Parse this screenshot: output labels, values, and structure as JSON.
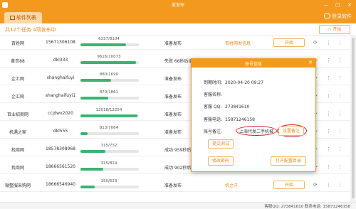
{
  "window": {
    "title": "爱发布",
    "minimize": "—",
    "maximize": "▢",
    "close": "✕"
  },
  "tabs": {
    "active": "软件列表"
  },
  "header": {
    "login": "登录软件"
  },
  "summary": {
    "text": "共12个任务 4项发布中",
    "start_all": "开始"
  },
  "columns_rows": [
    {
      "site": "百姓网",
      "account": "15671306108",
      "progress": "6337/8104",
      "progress_fraction": 0.78,
      "status": "准备发布",
      "log": "百姓网发信息",
      "button": "开始"
    },
    {
      "site": "黄页88",
      "account": "dkl333",
      "progress": "9616/10073",
      "progress_fraction": 0.95,
      "status": "失败 66秒后继",
      "log": "",
      "button": ""
    },
    {
      "site": "企汇网",
      "account": "shanghaifuyi",
      "progress": "880/1690",
      "progress_fraction": 0.52,
      "status": "准备发布",
      "log": "",
      "button": ""
    },
    {
      "site": "企汇网",
      "account": "shanghaifuyi1",
      "progress": "879/1861",
      "progress_fraction": 0.47,
      "status": "准备发布",
      "log": "",
      "button": ""
    },
    {
      "site": "百业招商网",
      "account": "ccjdwx2020",
      "progress": "12018/12254",
      "progress_fraction": 0.98,
      "status": "准备发布",
      "log": "",
      "button": ""
    },
    {
      "site": "机遇之家",
      "account": "dkl555",
      "progress": "813/7064",
      "progress_fraction": 0.12,
      "status": "准备发布",
      "log": "",
      "button": ""
    },
    {
      "site": "找商网",
      "account": "18578308968",
      "progress": "315/732",
      "progress_fraction": 0.43,
      "status": "成功 959秒后继",
      "log": "",
      "button": ""
    },
    {
      "site": "找商网",
      "account": "18666561520",
      "progress": "315/814",
      "progress_fraction": 0.39,
      "status": "成功 902秒后继",
      "log": "",
      "button": ""
    },
    {
      "site": "微整服采购网",
      "account": "18666546940",
      "progress": "150/623",
      "progress_fraction": 0.24,
      "status": "准备发布",
      "log": "机之洋",
      "button": "开始"
    }
  ],
  "dialog": {
    "title": "账号信息",
    "close": "✕",
    "expire_label": "到期时间:",
    "expire_value": "2020-04-20 09:27",
    "service_name_label": "客服名称:",
    "service_qq_label": "客服 QQ:",
    "service_qq_value": "273841610",
    "service_phone_label": "客服电话:",
    "service_phone_value": "15871246158",
    "note_label": "账号备注:",
    "note_value": "上海代发二手机械",
    "set_note": "设置备注",
    "submit_test": "提交测试",
    "change_password": "修改密码",
    "open_config": "打开配置目录"
  },
  "footer": {
    "text": "客服QQ: 273841610  联系电话: 15871246158"
  },
  "colors": {
    "accent": "#f39a1e",
    "progress": "#3cb371",
    "highlight": "#d82020"
  }
}
